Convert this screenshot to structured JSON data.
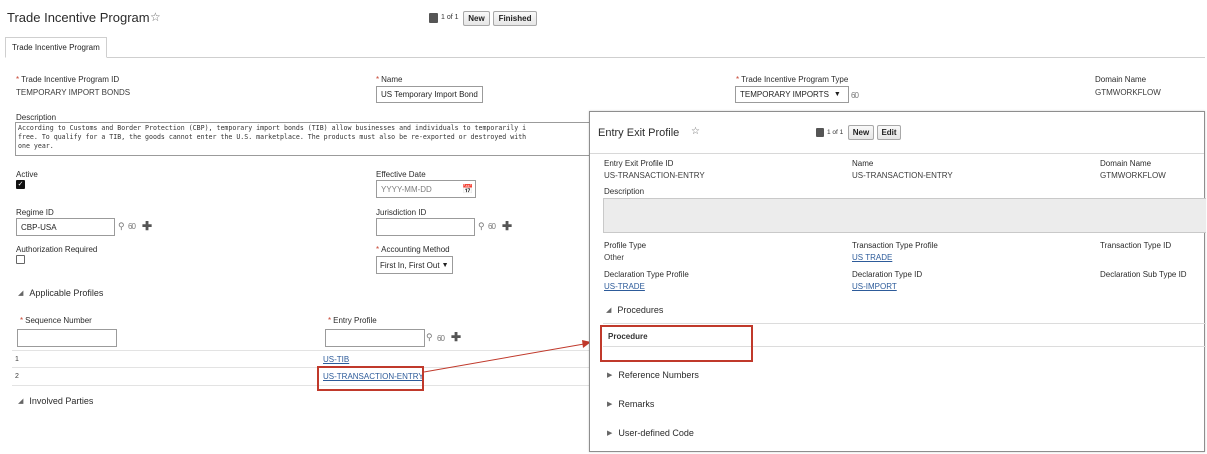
{
  "main": {
    "title": "Trade Incentive Program",
    "star": "☆",
    "pager": "1 of 1",
    "buttons": {
      "new": "New",
      "finished": "Finished"
    },
    "tab": "Trade Incentive Program",
    "fields": {
      "program_id_label": "Trade Incentive Program ID",
      "program_id_value": "TEMPORARY IMPORT BONDS",
      "name_label": "Name",
      "name_value": "US Temporary Import Bond",
      "type_label": "Trade Incentive Program Type",
      "type_value": "TEMPORARY IMPORTS",
      "domain_label": "Domain Name",
      "domain_value": "GTMWORKFLOW",
      "description_label": "Description",
      "description_lines": [
        "According to Customs and Border Protection (CBP), temporary import bonds (TIB) allow businesses and individuals to temporarily i",
        "free. To qualify for a TIB, the goods cannot enter the U.S. marketplace. The products must also be re-exported or destroyed with",
        "one year."
      ],
      "active_label": "Active",
      "effective_date_label": "Effective Date",
      "effective_date_placeholder": "YYYY-MM-DD",
      "regime_label": "Regime ID",
      "regime_value": "CBP-USA",
      "jurisdiction_label": "Jurisdiction ID",
      "auth_label": "Authorization Required",
      "accounting_label": "Accounting Method",
      "accounting_value": "First In, First Out"
    },
    "applicable_profiles": {
      "heading": "Applicable Profiles",
      "col_sequence": "Sequence Number",
      "col_entry": "Entry Profile",
      "rows": [
        {
          "seq": "1",
          "profile": "US-TIB"
        },
        {
          "seq": "2",
          "profile": "US-TRANSACTION-ENTRY"
        }
      ]
    },
    "involved_parties": "Involved Parties"
  },
  "popup": {
    "title": "Entry Exit Profile",
    "star": "☆",
    "pager": "1 of 1",
    "buttons": {
      "new": "New",
      "edit": "Edit"
    },
    "fields": {
      "profile_id_label": "Entry Exit Profile ID",
      "profile_id_value": "US-TRANSACTION-ENTRY",
      "name_label": "Name",
      "name_value": "US-TRANSACTION-ENTRY",
      "domain_label": "Domain Name",
      "domain_value": "GTMWORKFLOW",
      "description_label": "Description",
      "profile_type_label": "Profile Type",
      "profile_type_value": "Other",
      "txn_type_profile_label": "Transaction Type Profile",
      "txn_type_profile_value": "US TRADE",
      "txn_type_id_label": "Transaction Type ID",
      "decl_type_profile_label": "Declaration Type Profile",
      "decl_type_profile_value": "US-TRADE",
      "decl_type_id_label": "Declaration Type ID",
      "decl_type_id_value": "US-IMPORT",
      "decl_sub_type_label": "Declaration Sub Type ID"
    },
    "sections": {
      "procedures": "Procedures",
      "procedure_col": "Procedure",
      "reference_numbers": "Reference Numbers",
      "remarks": "Remarks",
      "user_defined": "User-defined Code"
    }
  },
  "colors": {
    "highlight": "#c0392b",
    "link": "#2d5b9a",
    "required": "#c74634"
  }
}
